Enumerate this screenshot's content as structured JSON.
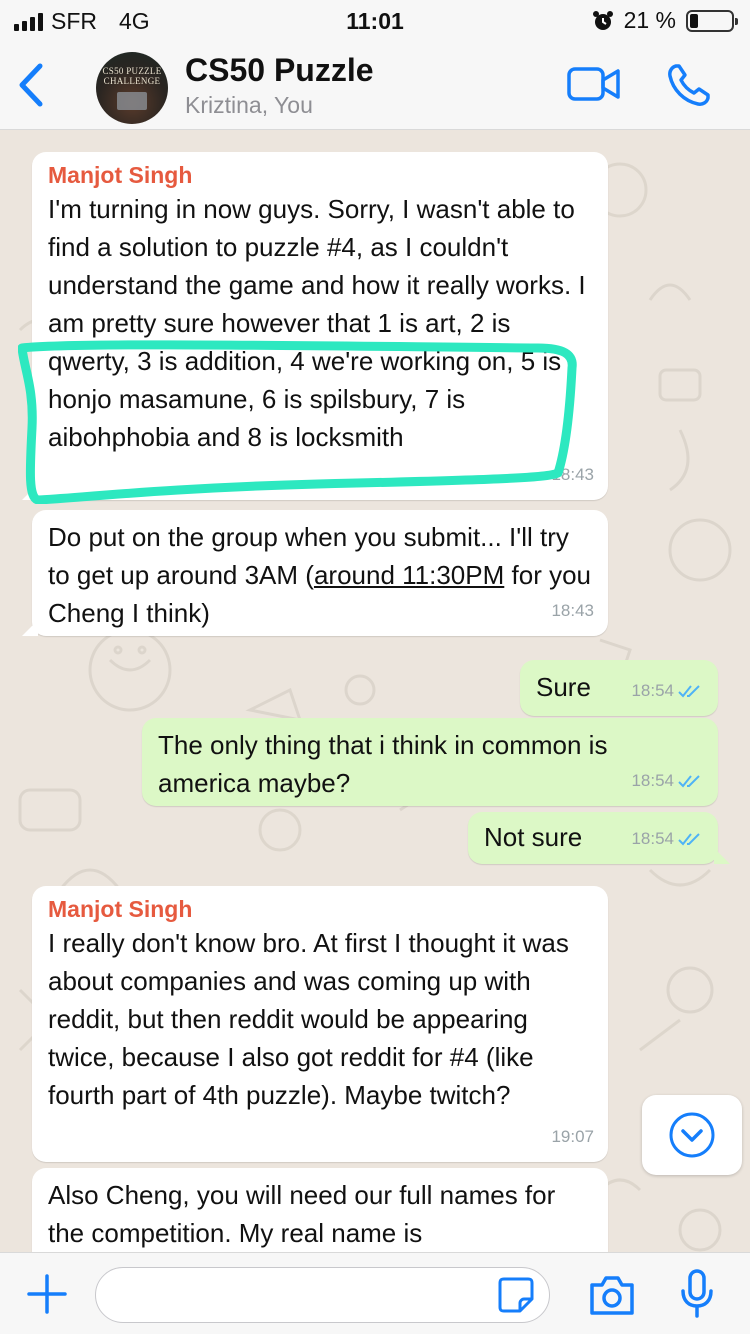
{
  "status_bar": {
    "carrier": "SFR",
    "network": "4G",
    "time": "11:01",
    "battery_percent": "21 %",
    "battery_level": 0.21
  },
  "header": {
    "back_label": "Back",
    "title": "CS50 Puzzle",
    "subtitle": "Kriztina, You",
    "avatar_text": [
      "CS50 PUZZLE",
      "CHALLENGE"
    ]
  },
  "colors": {
    "accent": "#157efb",
    "sender_name": "#e65a3f",
    "outgoing_bubble": "#dcf8c6",
    "incoming_bubble": "#ffffff",
    "highlight": "#2de8c0",
    "read_ticks": "#4fb3f6"
  },
  "messages": [
    {
      "direction": "in",
      "sender": "Manjot Singh",
      "text": "I'm turning in now guys. Sorry, I wasn't able to find a solution to puzzle #4, as I couldn't understand the game and how it really works. I am pretty sure however that 1 is art, 2 is qwerty, 3 is addition, 4 we're working on, 5 is honjo masamune, 6 is spilsbury, 7 is aibohphobia and 8 is locksmith",
      "time": "18:43"
    },
    {
      "direction": "in",
      "text_before": "Do put on the group when you submit... I'll try to get up around 3AM (",
      "text_link": "around 11:30PM",
      "text_after": " for you Cheng I think)",
      "time": "18:43"
    },
    {
      "direction": "out",
      "text": "Sure",
      "time": "18:54",
      "status": "read"
    },
    {
      "direction": "out",
      "text": "The only thing that i think in common is america maybe?",
      "time": "18:54",
      "status": "read"
    },
    {
      "direction": "out",
      "text": "Not sure",
      "time": "18:54",
      "status": "read"
    },
    {
      "direction": "in",
      "sender": "Manjot Singh",
      "text": "I really don't know bro. At first I thought it was about companies and was coming up with reddit, but then reddit would be appearing twice, because I also got reddit for #4 (like fourth part of 4th puzzle). Maybe twitch?",
      "time": "19:07"
    },
    {
      "direction": "in",
      "text": "Also Cheng, you will need our full names for the competition. My real name is",
      "time": ""
    }
  ],
  "input": {
    "placeholder": "",
    "value": ""
  },
  "icons": {
    "back": "chevron-left-icon",
    "video": "video-camera-icon",
    "call": "phone-icon",
    "attach": "plus-icon",
    "sticker": "sticker-icon",
    "camera": "camera-icon",
    "mic": "microphone-icon",
    "scroll": "chevron-down-circle-icon"
  }
}
